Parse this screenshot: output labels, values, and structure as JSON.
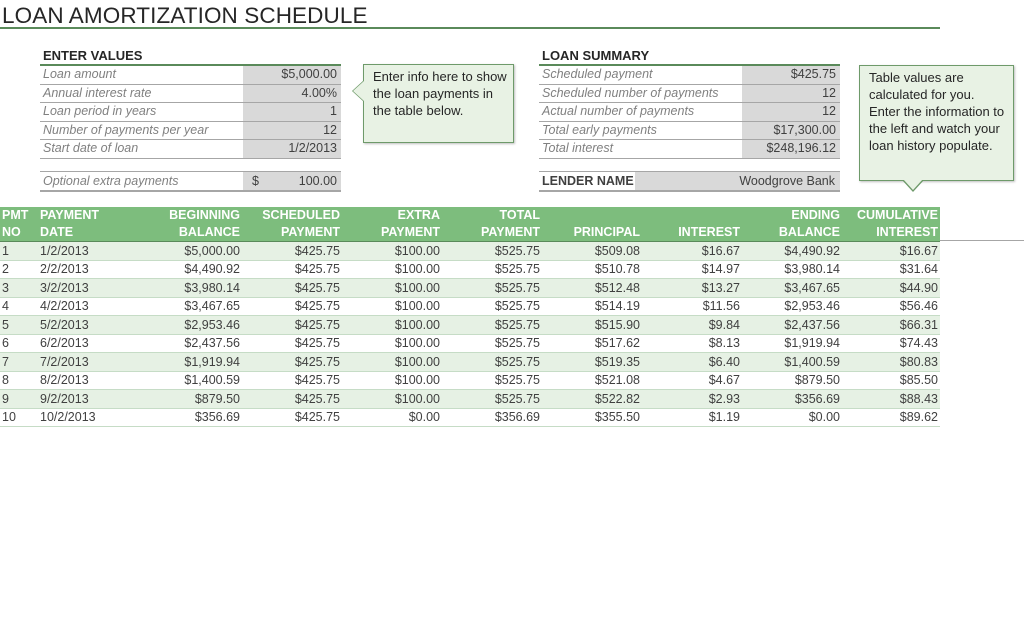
{
  "title": "LOAN AMORTIZATION SCHEDULE",
  "enter_values": {
    "heading": "ENTER VALUES",
    "rows": [
      {
        "label": "Loan amount",
        "value": "$5,000.00"
      },
      {
        "label": "Annual interest rate",
        "value": "4.00%"
      },
      {
        "label": "Loan period in years",
        "value": "1"
      },
      {
        "label": "Number of payments per year",
        "value": "12"
      },
      {
        "label": "Start date of loan",
        "value": "1/2/2013"
      }
    ],
    "extra": {
      "label": "Optional extra payments",
      "currency": "$",
      "value": "100.00"
    }
  },
  "loan_summary": {
    "heading": "LOAN SUMMARY",
    "rows": [
      {
        "label": "Scheduled payment",
        "value": "$425.75"
      },
      {
        "label": "Scheduled number of payments",
        "value": "12"
      },
      {
        "label": "Actual number of payments",
        "value": "12"
      },
      {
        "label": "Total early payments",
        "value": "$17,300.00"
      },
      {
        "label": "Total interest",
        "value": "$248,196.12"
      }
    ],
    "lender": {
      "label": "LENDER NAME",
      "value": "Woodgrove Bank"
    }
  },
  "callouts": {
    "left": "Enter info here to show the loan payments in the table below.",
    "right": "Table values are calculated for you. Enter the information to the left and watch your loan history populate."
  },
  "schedule": {
    "headers": [
      {
        "line1": "PMT",
        "line2": "NO"
      },
      {
        "line1": "PAYMENT",
        "line2": "DATE"
      },
      {
        "line1": "BEGINNING",
        "line2": "BALANCE"
      },
      {
        "line1": "SCHEDULED",
        "line2": "PAYMENT"
      },
      {
        "line1": "EXTRA",
        "line2": "PAYMENT"
      },
      {
        "line1": "TOTAL",
        "line2": "PAYMENT"
      },
      {
        "line1": "",
        "line2": "PRINCIPAL"
      },
      {
        "line1": "",
        "line2": "INTEREST"
      },
      {
        "line1": "ENDING",
        "line2": "BALANCE"
      },
      {
        "line1": "CUMULATIVE",
        "line2": "INTEREST"
      }
    ],
    "rows": [
      [
        "1",
        "1/2/2013",
        "$5,000.00",
        "$425.75",
        "$100.00",
        "$525.75",
        "$509.08",
        "$16.67",
        "$4,490.92",
        "$16.67"
      ],
      [
        "2",
        "2/2/2013",
        "$4,490.92",
        "$425.75",
        "$100.00",
        "$525.75",
        "$510.78",
        "$14.97",
        "$3,980.14",
        "$31.64"
      ],
      [
        "3",
        "3/2/2013",
        "$3,980.14",
        "$425.75",
        "$100.00",
        "$525.75",
        "$512.48",
        "$13.27",
        "$3,467.65",
        "$44.90"
      ],
      [
        "4",
        "4/2/2013",
        "$3,467.65",
        "$425.75",
        "$100.00",
        "$525.75",
        "$514.19",
        "$11.56",
        "$2,953.46",
        "$56.46"
      ],
      [
        "5",
        "5/2/2013",
        "$2,953.46",
        "$425.75",
        "$100.00",
        "$525.75",
        "$515.90",
        "$9.84",
        "$2,437.56",
        "$66.31"
      ],
      [
        "6",
        "6/2/2013",
        "$2,437.56",
        "$425.75",
        "$100.00",
        "$525.75",
        "$517.62",
        "$8.13",
        "$1,919.94",
        "$74.43"
      ],
      [
        "7",
        "7/2/2013",
        "$1,919.94",
        "$425.75",
        "$100.00",
        "$525.75",
        "$519.35",
        "$6.40",
        "$1,400.59",
        "$80.83"
      ],
      [
        "8",
        "8/2/2013",
        "$1,400.59",
        "$425.75",
        "$100.00",
        "$525.75",
        "$521.08",
        "$4.67",
        "$879.50",
        "$85.50"
      ],
      [
        "9",
        "9/2/2013",
        "$879.50",
        "$425.75",
        "$100.00",
        "$525.75",
        "$522.82",
        "$2.93",
        "$356.69",
        "$88.43"
      ],
      [
        "10",
        "10/2/2013",
        "$356.69",
        "$425.75",
        "$0.00",
        "$356.69",
        "$355.50",
        "$1.19",
        "$0.00",
        "$89.62"
      ]
    ]
  },
  "colors": {
    "accent_green": "#5a8a5a",
    "header_green": "#7dbd7d",
    "band_green": "#e6f1e4",
    "input_gray": "#d9d9d9",
    "callout_fill": "#e8f2e4"
  }
}
